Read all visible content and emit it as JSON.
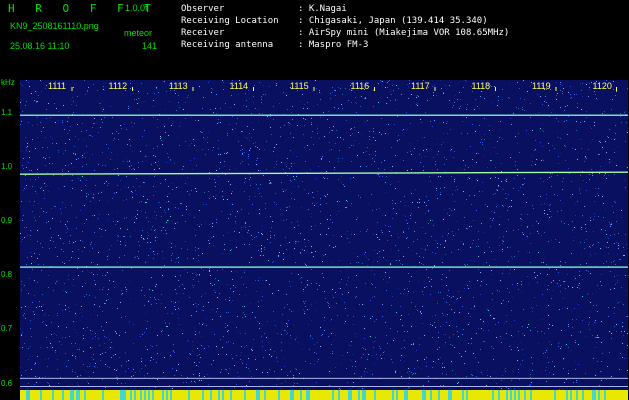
{
  "header": {
    "app_name": "H R O F F T",
    "version": "1.0.0f",
    "filename": "KN9_2508161110.png",
    "datetime": "25.08.16 11:10",
    "meteor_label": "meteor",
    "meteor_count": "141",
    "info_labels": [
      "Observer",
      "Receiving Location",
      "Receiver",
      "Receiving antenna"
    ],
    "info_values": [
      ": K.Nagai",
      ": Chigasaki, Japan (139.414 35.340)",
      ": AirSpy mini (Miakejima VOR 108.65MHz)",
      ": Maspro FM-3"
    ]
  },
  "chart_data": {
    "type": "heatmap",
    "ylabel": "kHz",
    "x_ticks": [
      "1111",
      "1112",
      "1113",
      "1114",
      "1115",
      "1116",
      "1117",
      "1118",
      "1119",
      "1120"
    ],
    "y_ticks": [
      "1.1",
      "1.0",
      "0.9",
      "0.8",
      "0.7",
      "0.6"
    ],
    "y_range": [
      0.57,
      1.16
    ],
    "signal_lines_khz": [
      1.095,
      0.99,
      0.815
    ]
  },
  "colors": {
    "background": "#000000",
    "label": "#00e000",
    "text": "#ffffff",
    "noise": "#1a2aa0"
  }
}
